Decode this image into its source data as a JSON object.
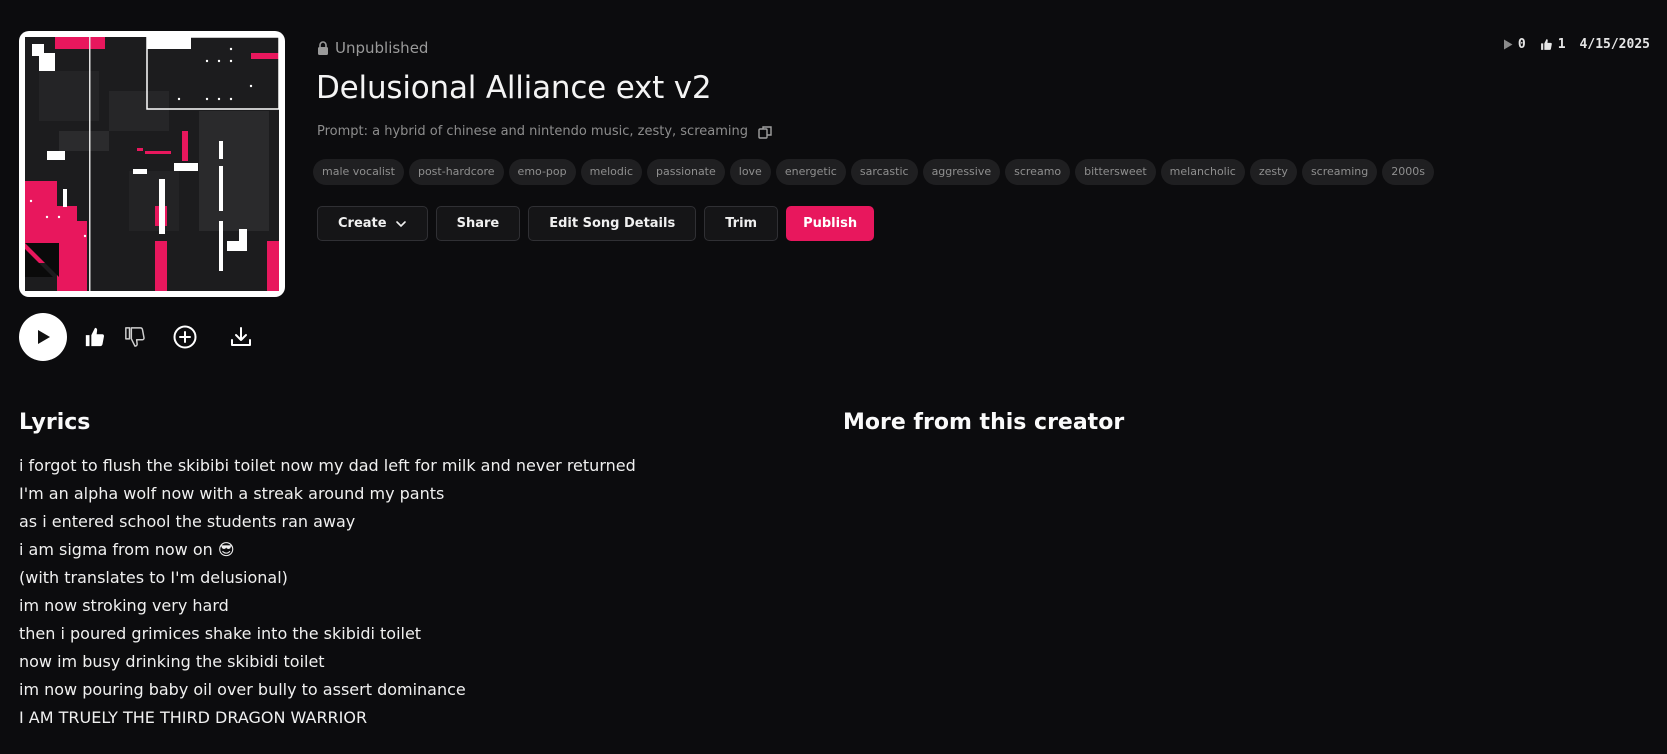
{
  "song": {
    "status": "Unpublished",
    "title": "Delusional Alliance ext v2",
    "prompt": "Prompt: a hybrid of chinese and nintendo music, zesty, screaming",
    "tags": [
      "male vocalist",
      "post-hardcore",
      "emo-pop",
      "melodic",
      "passionate",
      "love",
      "energetic",
      "sarcastic",
      "aggressive",
      "screamo",
      "bittersweet",
      "melancholic",
      "zesty",
      "screaming",
      "2000s"
    ]
  },
  "stats": {
    "plays": "0",
    "likes": "1",
    "date": "4/15/2025"
  },
  "actions": {
    "create": "Create",
    "share": "Share",
    "edit": "Edit Song Details",
    "trim": "Trim",
    "publish": "Publish"
  },
  "lyrics": {
    "heading": "Lyrics",
    "lines": [
      "i forgot to flush the skibibi toilet now my dad left for milk and never returned",
      "I'm an alpha wolf now with a streak around my pants",
      "as i entered school the students ran away",
      "i am sigma from now on 😎",
      "(with translates to I'm delusional)",
      "im now stroking very hard",
      "then i poured grimices shake into the skibidi toilet",
      "now im busy drinking the skibidi toilet",
      "im now pouring baby oil over bully to assert dominance",
      "I AM TRUELY THE THIRD DRAGON WARRIOR"
    ]
  },
  "more": {
    "heading": "More from this creator"
  },
  "colors": {
    "accent": "#e8175d",
    "background": "#0c0c0e"
  },
  "icons": [
    "lock-icon",
    "copy-icon",
    "play-icon",
    "thumbs-up-icon",
    "thumbs-down-icon",
    "add-circle-icon",
    "download-icon",
    "chevron-down-icon"
  ]
}
